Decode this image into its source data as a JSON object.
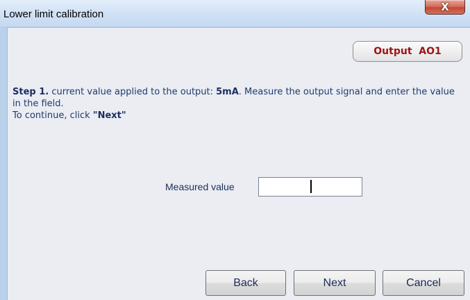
{
  "window": {
    "title": "Lower limit calibration",
    "close_glyph": "X"
  },
  "badge": {
    "label": "Output  AO1"
  },
  "instructions": {
    "step_label": "Step 1.",
    "text_before_value": " current value applied to the output: ",
    "value": "5mA",
    "text_after_value": ". Measure the output signal and enter the value in the field.",
    "continue_text": "To continue, click ",
    "continue_button_name": "\"Next\""
  },
  "measure": {
    "label": "Measured value",
    "value": ""
  },
  "buttons": {
    "back": "Back",
    "next": "Next",
    "cancel": "Cancel"
  },
  "colors": {
    "badge_text": "#9e1414",
    "client_background": "#ebedf3",
    "instruction_text": "#1f3b6b"
  },
  "icons": {
    "close": "close-icon"
  }
}
